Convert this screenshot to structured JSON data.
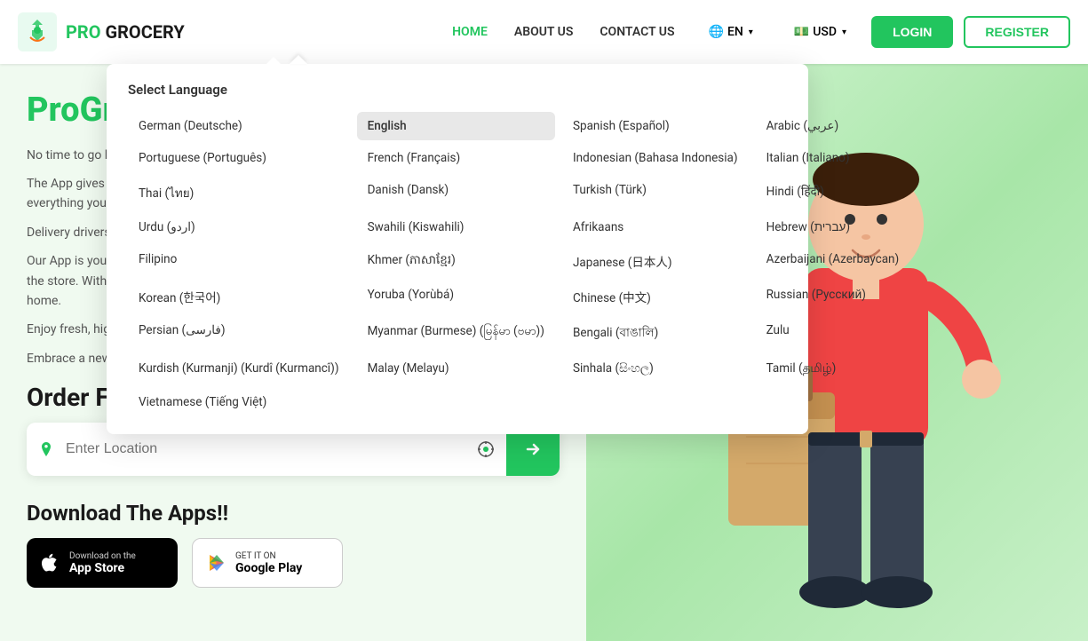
{
  "header": {
    "logo_pro": "PRO",
    "logo_grocery": " GROCERY",
    "nav": [
      {
        "label": "HOME",
        "id": "home",
        "active": true
      },
      {
        "label": "ABOUT US",
        "id": "about"
      },
      {
        "label": "CONTACT US",
        "id": "contact"
      }
    ],
    "language": {
      "globe": "🌐",
      "code": "EN",
      "chevron": "▾"
    },
    "currency": {
      "flag": "💵",
      "code": "USD",
      "chevron": "▾"
    },
    "login_label": "LOGIN",
    "register_label": "REGISTER"
  },
  "hero": {
    "title_line1": "ProGro",
    "title_line2": "Groceries",
    "desc1": "No time to go buying groceries? Try Pro Grocery and get your Groceries delivered fast.",
    "desc2": "The App gives you a seamless shopping experience no matter how busy, so you can order everything you need with just a few taps, packed and delivered right to your door.",
    "desc3": "Delivery drivers are available around the clock.",
    "desc4": "Our App is your one-stop shop for all your grocery needs. Say goodbye to the hassle of going to the store. With our App, you can easily shop for all your grocery needs from the comfort of your home.",
    "desc5": "Enjoy fresh, high-quality groceries right at your fingertips, smartphones,",
    "desc6": "Embrace a new way of grocery shopping."
  },
  "order_section": {
    "title": "Order From Stores Near You",
    "location_placeholder": "Enter Location",
    "location_icon": "📍",
    "gps_icon": "◎",
    "go_icon": "→"
  },
  "download": {
    "title": "Download The Apps!!",
    "app_store": {
      "sub": "Download on the",
      "main": "App Store"
    },
    "google_play": {
      "sub": "GET IT ON",
      "main": "Google Play"
    }
  },
  "language_dropdown": {
    "title": "Select Language",
    "languages": [
      {
        "label": "German (Deutsche)",
        "col": 1,
        "selected": false
      },
      {
        "label": "English",
        "col": 2,
        "selected": true
      },
      {
        "label": "Spanish (Español)",
        "col": 3,
        "selected": false
      },
      {
        "label": "Arabic (عربي)",
        "col": 4,
        "selected": false
      },
      {
        "label": "Portuguese (Português)",
        "col": 1,
        "selected": false
      },
      {
        "label": "French (Français)",
        "col": 2,
        "selected": false
      },
      {
        "label": "Indonesian (Bahasa Indonesia)",
        "col": 3,
        "selected": false
      },
      {
        "label": "Italian (Italiano)",
        "col": 4,
        "selected": false
      },
      {
        "label": "Thai (ไทย)",
        "col": 1,
        "selected": false
      },
      {
        "label": "Danish (Dansk)",
        "col": 2,
        "selected": false
      },
      {
        "label": "Turkish (Türk)",
        "col": 3,
        "selected": false
      },
      {
        "label": "Hindi (हिंदी)",
        "col": 4,
        "selected": false
      },
      {
        "label": "Urdu (اردو)",
        "col": 1,
        "selected": false
      },
      {
        "label": "Swahili (Kiswahili)",
        "col": 2,
        "selected": false
      },
      {
        "label": "Afrikaans",
        "col": 3,
        "selected": false
      },
      {
        "label": "Hebrew (עברית)",
        "col": 4,
        "selected": false
      },
      {
        "label": "Filipino",
        "col": 1,
        "selected": false
      },
      {
        "label": "Khmer (ភាសាខ្មែរ)",
        "col": 2,
        "selected": false
      },
      {
        "label": "Japanese (日本人)",
        "col": 3,
        "selected": false
      },
      {
        "label": "Azerbaijani (Azerbaycan)",
        "col": 4,
        "selected": false
      },
      {
        "label": "Korean (한국어)",
        "col": 1,
        "selected": false
      },
      {
        "label": "Yoruba (Yorùbá)",
        "col": 2,
        "selected": false
      },
      {
        "label": "Chinese (中文)",
        "col": 3,
        "selected": false
      },
      {
        "label": "Russian (Русский)",
        "col": 4,
        "selected": false
      },
      {
        "label": "Persian (فارسی)",
        "col": 1,
        "selected": false
      },
      {
        "label": "Myanmar (Burmese) (မြန်မာ (ဗမာ))",
        "col": 2,
        "selected": false
      },
      {
        "label": "Bengali (বাঙালি)",
        "col": 3,
        "selected": false
      },
      {
        "label": "Zulu",
        "col": 4,
        "selected": false
      },
      {
        "label": "Kurdish (Kurmanji) (Kurdî (Kurmancî))",
        "col": 1,
        "selected": false
      },
      {
        "label": "Malay (Melayu)",
        "col": 2,
        "selected": false
      },
      {
        "label": "Sinhala (සිංහල)",
        "col": 3,
        "selected": false
      },
      {
        "label": "Tamil (தமிழ்)",
        "col": 4,
        "selected": false
      },
      {
        "label": "Vietnamese (Tiếng Việt)",
        "col": 1,
        "selected": false
      }
    ]
  }
}
